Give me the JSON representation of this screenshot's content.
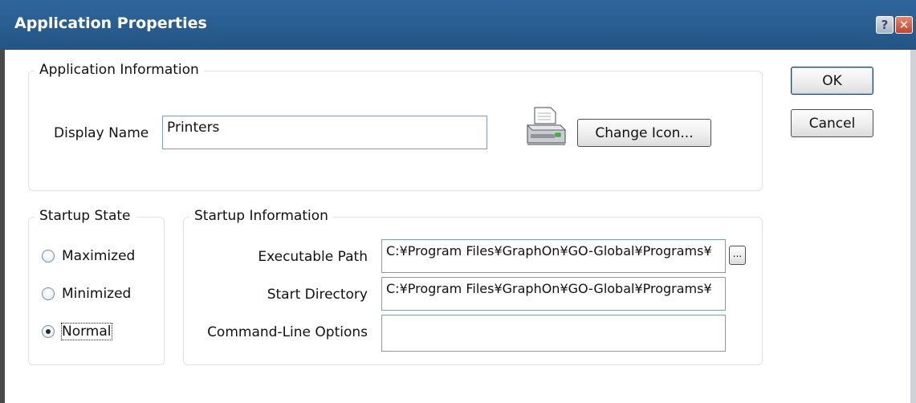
{
  "window": {
    "title": "Application Properties"
  },
  "buttons": {
    "ok": "OK",
    "cancel": "Cancel",
    "change_icon": "Change Icon...",
    "browse": "..."
  },
  "app_info": {
    "group_label": "Application Information",
    "display_name_label": "Display Name",
    "display_name_value": "Printers",
    "icon": "printer-icon"
  },
  "startup_state": {
    "group_label": "Startup State",
    "options": [
      {
        "label": "Maximized",
        "selected": false
      },
      {
        "label": "Minimized",
        "selected": false
      },
      {
        "label": "Normal",
        "selected": true
      }
    ]
  },
  "startup_info": {
    "group_label": "Startup Information",
    "executable_path_label": "Executable Path",
    "executable_path_value": "C:¥Program Files¥GraphOn¥GO-Global¥Programs¥",
    "start_directory_label": "Start Directory",
    "start_directory_value": "C:¥Program Files¥GraphOn¥GO-Global¥Programs¥",
    "command_line_label": "Command-Line Options",
    "command_line_value": ""
  }
}
